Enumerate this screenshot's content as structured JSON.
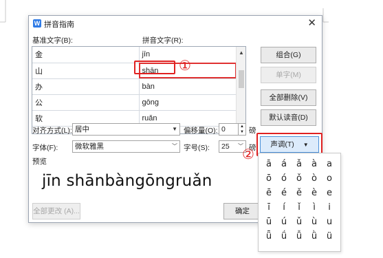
{
  "dialog": {
    "title": "拼音指南",
    "app_icon_glyph": "W",
    "close_glyph": "✕"
  },
  "labels": {
    "base_text": "基准文字(B):",
    "pinyin_text": "拼音文字(R):",
    "align": "对齐方式(L):",
    "offset": "偏移量(O):",
    "offset_unit": "磅",
    "font": "字体(F):",
    "size": "字号(S):",
    "size_unit": "磅",
    "preview": "预览"
  },
  "rows": [
    {
      "base": "金",
      "pinyin": "jīn"
    },
    {
      "base": "山",
      "pinyin": "shān"
    },
    {
      "base": "办",
      "pinyin": "bàn"
    },
    {
      "base": "公",
      "pinyin": "gōng"
    },
    {
      "base": "软",
      "pinyin": "ruǎn"
    }
  ],
  "selected_row_index": 1,
  "fields": {
    "align_value": "居中",
    "offset_value": "0",
    "font_value": "微软雅黑",
    "size_value": "25"
  },
  "buttons": {
    "combine": "组合(G)",
    "single": "单字(M)",
    "delete_all": "全部删除(V)",
    "default_reading": "默认读音(D)",
    "tone": "声调(T)",
    "change_all": "全部更改 (A)...",
    "ok": "确定"
  },
  "preview_text": "jīn shānbàngōngruǎn",
  "annotations": {
    "marker_1": "①",
    "marker_2": "②",
    "color": "#e02020"
  },
  "tone_grid": [
    [
      "ā",
      "á",
      "ǎ",
      "à",
      "a"
    ],
    [
      "ō",
      "ó",
      "ǒ",
      "ò",
      "o"
    ],
    [
      "ē",
      "é",
      "ě",
      "è",
      "e"
    ],
    [
      "ī",
      "í",
      "ǐ",
      "ì",
      "i"
    ],
    [
      "ū",
      "ú",
      "ǔ",
      "ù",
      "u"
    ],
    [
      "ǖ",
      "ǘ",
      "ǚ",
      "ǜ",
      "ü"
    ]
  ],
  "colors": {
    "accent": "#2f7be6",
    "highlight": "#e02020",
    "active_button": "#dcebfb"
  }
}
